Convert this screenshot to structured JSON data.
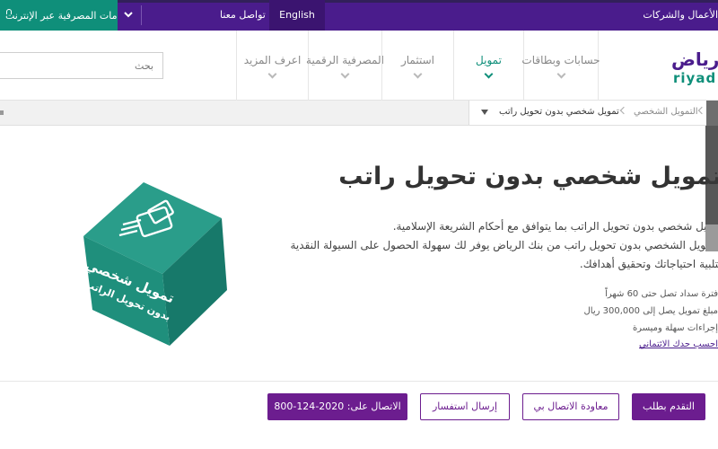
{
  "topbar": {
    "online_banking": "الخدمات المصرفية عبر الإنترنت",
    "contact_us": "تواصل معنا",
    "language": "English",
    "business": "الأعمال والشركات",
    "chevron": "❯"
  },
  "logo": {
    "arabic": "رياض",
    "english": "riyad"
  },
  "search": {
    "placeholder": "بحث"
  },
  "nav": {
    "items": [
      {
        "label": "حسابات وبطاقات"
      },
      {
        "label": "تمويل"
      },
      {
        "label": "استثمار"
      },
      {
        "label": "المصرفية الرقمية"
      },
      {
        "label": "اعرف المزيد"
      }
    ]
  },
  "breadcrumb": {
    "items": [
      {
        "label": "التمويل الشخصي"
      },
      {
        "label": "تمويل شخصي بدون تحويل راتب"
      }
    ]
  },
  "content": {
    "title": "تمويل شخصي بدون تحويل راتب",
    "para1": "تمويل شخصي بدون تحويل الراتب بما يتوافق مع أحكام الشريعة الإسلامية.",
    "para2": "التمويل الشخصي بدون تحويل راتب من بنك الرياض يوفر لك سهولة الحصول على السيولة النقدية",
    "para3": "لتلبية احتياجاتك وتحقيق أهدافك.",
    "features": [
      "فترة سداد تصل حتى 60 شهراً",
      "مبلغ تمويل يصل إلى 300,000 ريال",
      "إجراءات سهلة وميسرة"
    ],
    "link": "احسب حدك الائتماني"
  },
  "cube": {
    "line1": "تمويل شخصي",
    "line2": "بدون تحويل الراتب"
  },
  "buttons": {
    "apply": "التقدم بطلب",
    "call_back": "معاودة الاتصال بي",
    "inquiry": "إرسال استفسار",
    "call": "الاتصال على: 2020-124-800"
  },
  "colors": {
    "brand_purple": "#4a1c8c",
    "brand_green": "#0f8f7a",
    "button_purple": "#6c1d8f"
  }
}
